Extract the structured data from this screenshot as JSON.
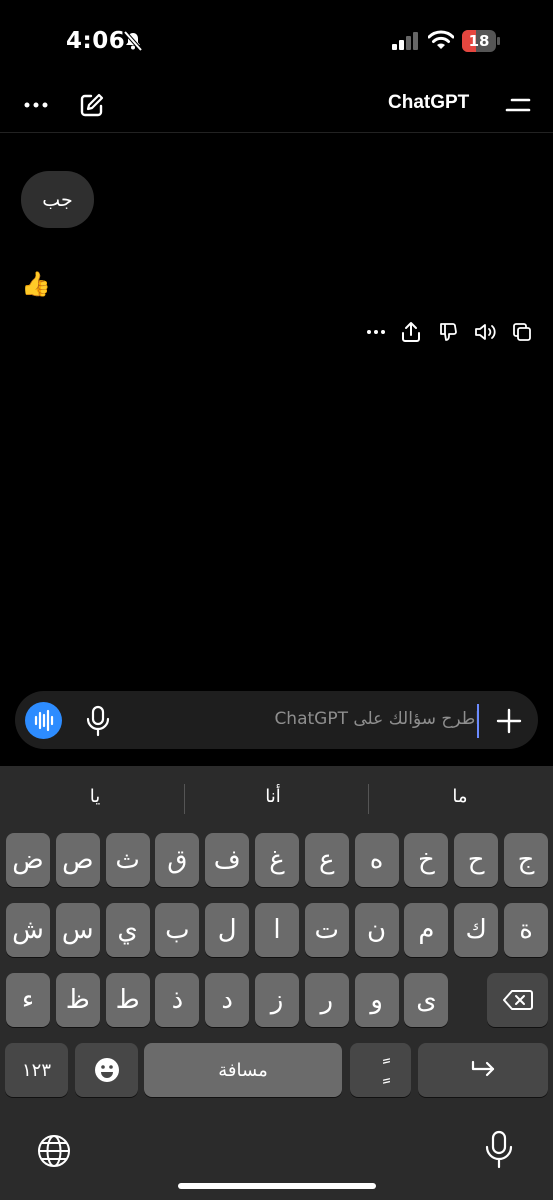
{
  "status_bar": {
    "time": "4:06",
    "battery": "18"
  },
  "header": {
    "title": "ChatGPT"
  },
  "chat": {
    "user_message": "جب",
    "assistant_reply": "👍"
  },
  "composer": {
    "placeholder": "اطرح سؤالك على ChatGPT"
  },
  "keyboard": {
    "suggestions": [
      "يا",
      "أنا",
      "ما"
    ],
    "row1": [
      "ض",
      "ص",
      "ث",
      "ق",
      "ف",
      "غ",
      "ع",
      "ه",
      "خ",
      "ح",
      "ج"
    ],
    "row2": [
      "ش",
      "س",
      "ي",
      "ب",
      "ل",
      "ا",
      "ت",
      "ن",
      "م",
      "ك",
      "ة"
    ],
    "row3": [
      "ء",
      "ظ",
      "ط",
      "ذ",
      "د",
      "ز",
      "ر",
      "و",
      "ى"
    ],
    "numbers_label": "١٢٣",
    "space_label": "مسافة",
    "diacritic_label": "ًٍ"
  },
  "colors": {
    "accent": "#2d8cff",
    "background": "#000000",
    "bubble": "#2f2f2f",
    "battery_red": "#e5463f"
  }
}
